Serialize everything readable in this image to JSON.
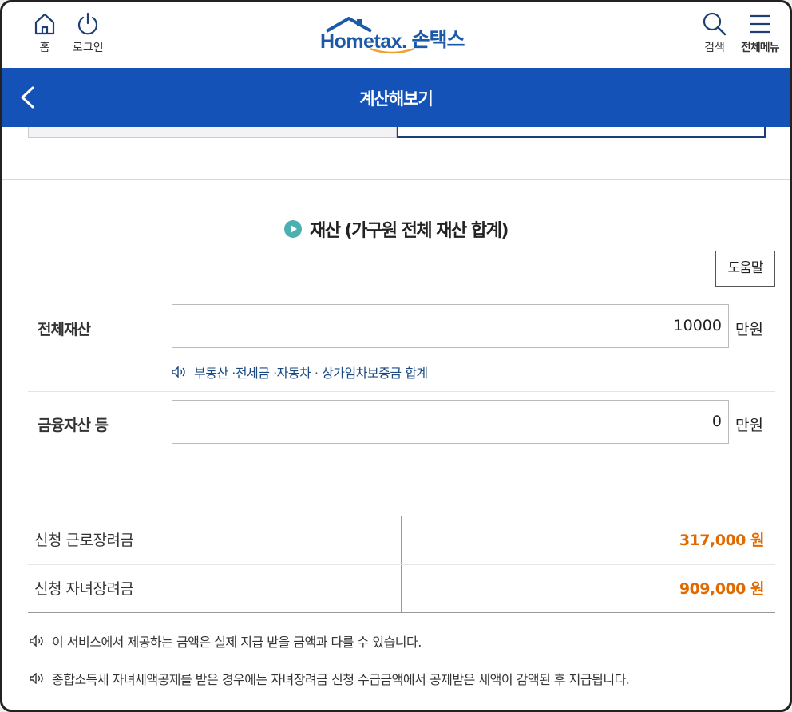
{
  "header": {
    "home_label": "홈",
    "login_label": "로그인",
    "logo_text": "Hometax.",
    "logo_ko": "손택스",
    "search_label": "검색",
    "menu_label": "전체메뉴"
  },
  "titlebar": {
    "title": "계산해보기"
  },
  "section": {
    "title": "재산 (가구원 전체 재산 합계)",
    "help_button": "도움말"
  },
  "fields": {
    "total_assets": {
      "label": "전체재산",
      "value": "10000",
      "unit": "만원",
      "hint": "부동산 ·전세금 ·자동차 · 상가임차보증금 합계"
    },
    "financial_assets": {
      "label": "금융자산 등",
      "value": "0",
      "unit": "만원"
    }
  },
  "results": [
    {
      "label": "신청 근로장려금",
      "value": "317,000 원"
    },
    {
      "label": "신청 자녀장려금",
      "value": "909,000 원"
    }
  ],
  "notes": [
    "이 서비스에서 제공하는 금액은 실제 지급 받을 금액과 다를 수 있습니다.",
    "종합소득세 자녀세액공제를 받은 경우에는 자녀장려금 신청 수급금액에서 공제받은 세액이 감액된 후 지급됩니다."
  ],
  "colors": {
    "titlebar": "#1552b8",
    "result_value": "#e06a00",
    "hint_text": "#1a4a80",
    "play_icon": "#4db0b0"
  }
}
